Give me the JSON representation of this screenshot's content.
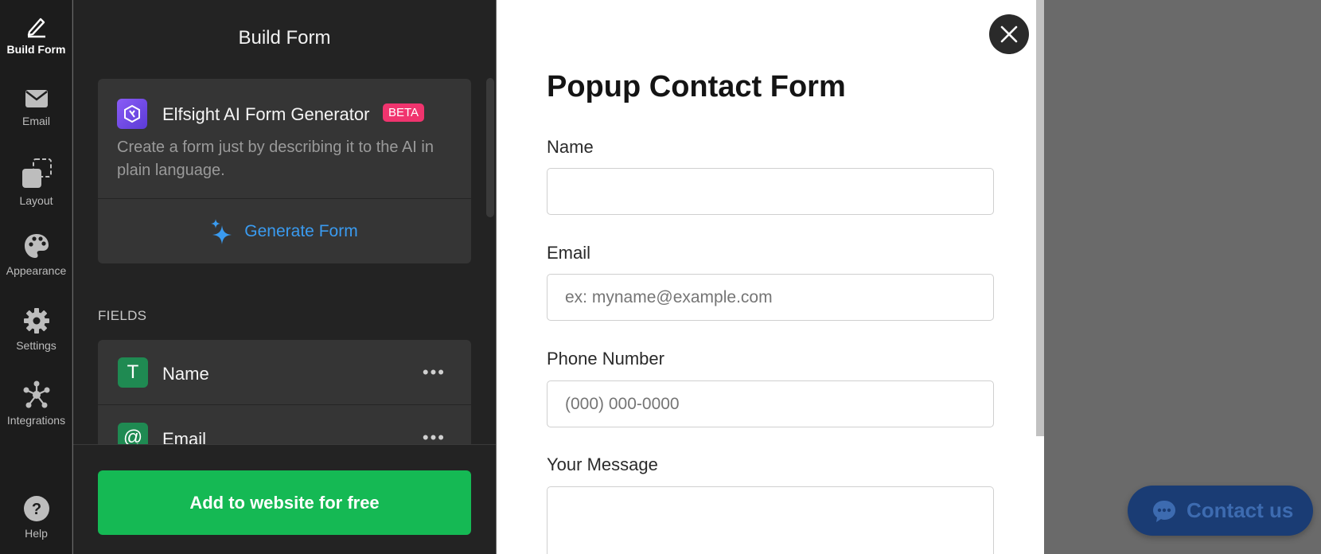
{
  "rail": {
    "items": [
      {
        "label": "Build Form",
        "icon": "pencil-icon"
      },
      {
        "label": "Email",
        "icon": "envelope-icon"
      },
      {
        "label": "Layout",
        "icon": "layout-icon"
      },
      {
        "label": "Appearance",
        "icon": "palette-icon"
      },
      {
        "label": "Settings",
        "icon": "gear-icon"
      },
      {
        "label": "Integrations",
        "icon": "network-icon"
      },
      {
        "label": "Help",
        "icon": "question-icon"
      }
    ]
  },
  "panel": {
    "title": "Build Form",
    "ai_card": {
      "title": "Elfsight AI Form Generator",
      "badge": "BETA",
      "description": "Create a form just by describing it to the AI in plain language.",
      "button": "Generate Form"
    },
    "fields_label": "FIELDS",
    "fields": [
      {
        "name": "Name",
        "icon_glyph": "T",
        "more": "•••"
      },
      {
        "name": "Email",
        "icon_glyph": "@",
        "more": "•••"
      }
    ],
    "cta": "Add to website for free"
  },
  "preview": {
    "title": "Popup Contact Form",
    "fields": [
      {
        "label": "Name",
        "placeholder": ""
      },
      {
        "label": "Email",
        "placeholder": "ex: myname@example.com"
      },
      {
        "label": "Phone Number",
        "placeholder": "(000) 000-0000"
      },
      {
        "label": "Your Message",
        "placeholder": ""
      }
    ]
  },
  "launcher": {
    "label": "Contact us"
  },
  "colors": {
    "accent_green": "#15b954",
    "accent_blue": "#3a9bf0",
    "beta_pink": "#f0346e",
    "launcher_bg": "#1a3c74"
  }
}
